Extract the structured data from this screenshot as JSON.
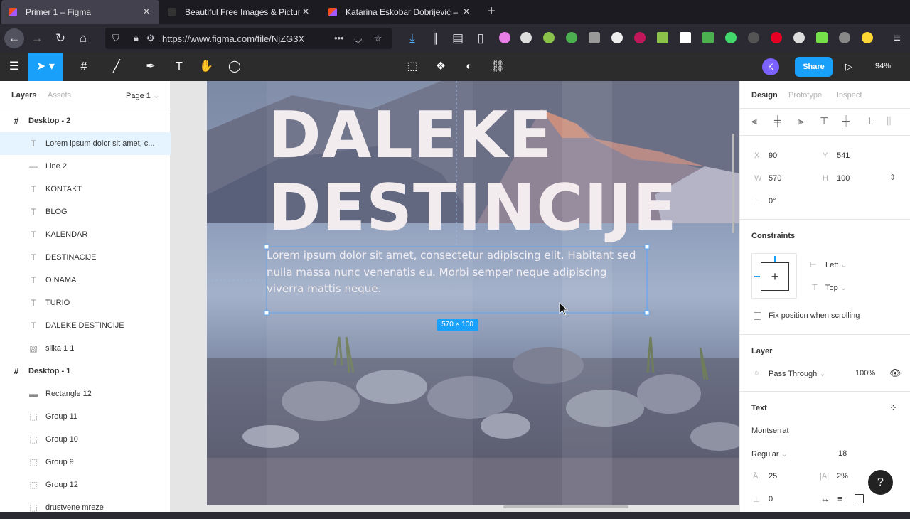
{
  "browser": {
    "tabs": [
      {
        "title": "Primer 1 – Figma",
        "active": true
      },
      {
        "title": "Beautiful Free Images & Pictures"
      },
      {
        "title": "Katarina Eskobar Dobrijević – Fi"
      }
    ],
    "url": "https://www.figma.com/file/NjZG3X"
  },
  "figma": {
    "avatar_initial": "K",
    "share_label": "Share",
    "zoom": "94%"
  },
  "layers_panel": {
    "tab_layers": "Layers",
    "tab_assets": "Assets",
    "page": "Page 1",
    "items": [
      {
        "label": "Desktop - 2",
        "kind": "frame"
      },
      {
        "label": "Lorem ipsum dolor sit amet, c...",
        "kind": "text",
        "selected": true
      },
      {
        "label": "Line 2",
        "kind": "line"
      },
      {
        "label": "KONTAKT",
        "kind": "text"
      },
      {
        "label": "BLOG",
        "kind": "text"
      },
      {
        "label": "KALENDAR",
        "kind": "text"
      },
      {
        "label": "DESTINACIJE",
        "kind": "text"
      },
      {
        "label": "O NAMA",
        "kind": "text"
      },
      {
        "label": "TURIO",
        "kind": "text"
      },
      {
        "label": "DALEKE DESTINCIJE",
        "kind": "text"
      },
      {
        "label": "slika 1 1",
        "kind": "image"
      },
      {
        "label": "Desktop - 1",
        "kind": "frame"
      },
      {
        "label": "Rectangle 12",
        "kind": "rect"
      },
      {
        "label": "Group 11",
        "kind": "group"
      },
      {
        "label": "Group 10",
        "kind": "group"
      },
      {
        "label": "Group 9",
        "kind": "group"
      },
      {
        "label": "Group 12",
        "kind": "group"
      },
      {
        "label": "drustvene mreze",
        "kind": "group"
      }
    ]
  },
  "canvas": {
    "headline_1": "DALEKE",
    "headline_2": "DESTINCIJE",
    "paragraph": "Lorem ipsum dolor sit amet, consectetur adipiscing elit. Habitant sed nulla massa nunc venenatis eu. Morbi semper neque adipiscing viverra mattis neque.",
    "size_badge": "570 × 100"
  },
  "design_panel": {
    "tabs": [
      "Design",
      "Prototype",
      "Inspect"
    ],
    "x_label": "X",
    "x": "90",
    "y_label": "Y",
    "y": "541",
    "w_label": "W",
    "w": "570",
    "h_label": "H",
    "h": "100",
    "rotation": "0°",
    "constraints_title": "Constraints",
    "constraint_h": "Left",
    "constraint_v": "Top",
    "fix_position": "Fix position when scrolling",
    "layer_title": "Layer",
    "blend": "Pass Through",
    "opacity": "100%",
    "text_title": "Text",
    "font": "Montserrat",
    "weight": "Regular",
    "size": "18",
    "line_height": "25",
    "letter_spacing": "2%",
    "paragraph_spacing": "0"
  },
  "colors": {
    "accent": "#18a0fb",
    "selection_bg": "#e5f4ff",
    "toolbar": "#2c2c2c"
  }
}
